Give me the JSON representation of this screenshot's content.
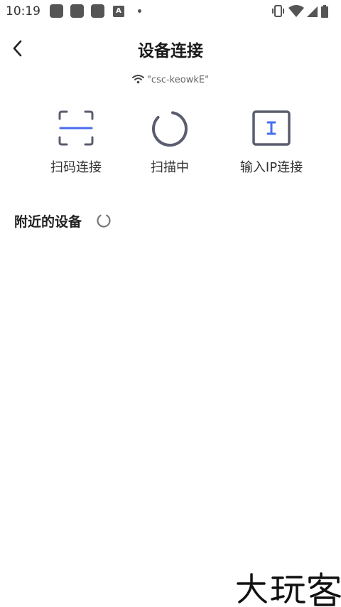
{
  "status_bar": {
    "time": "10:19",
    "notification_icons": [
      "app-icon",
      "app-icon",
      "app-icon",
      "translate-icon",
      "dot-icon"
    ],
    "system_icons": [
      "vibrate-icon",
      "wifi-icon",
      "cellular-icon",
      "battery-icon"
    ]
  },
  "header": {
    "back_icon": "chevron-left-icon",
    "title": "设备连接"
  },
  "network": {
    "icon": "wifi-icon",
    "ssid": "\"csc-keowkE\""
  },
  "actions": [
    {
      "label": "扫码连接",
      "icon": "scan-code-icon"
    },
    {
      "label": "扫描中",
      "icon": "scanning-spinner-icon"
    },
    {
      "label": "输入IP连接",
      "icon": "text-cursor-icon"
    }
  ],
  "nearby": {
    "title": "附近的设备",
    "loading_icon": "loading-spinner-icon"
  },
  "colors": {
    "accent": "#4a6cf0",
    "icon_gray": "#5a5d6e",
    "title": "#1a1a1a"
  }
}
